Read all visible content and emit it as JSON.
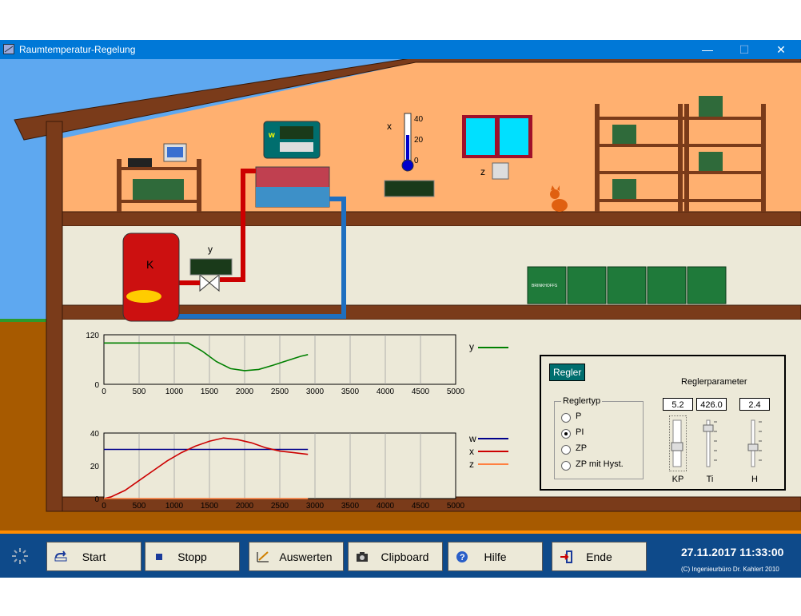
{
  "window": {
    "title": "Raumtemperatur-Regelung",
    "minimize": "—",
    "maximize": "☐",
    "close": "✕"
  },
  "scene": {
    "w_label": "w",
    "x_label": "x",
    "y_label": "y",
    "z_label": "z",
    "k_label": "K",
    "thermo_ticks": [
      "40",
      "20",
      "0"
    ],
    "crate_label": "BRINKHOFFS"
  },
  "chart_data": [
    {
      "type": "line",
      "xlim": [
        0,
        5000
      ],
      "ylim": [
        0,
        120
      ],
      "x_ticks": [
        "0",
        "500",
        "1000",
        "1500",
        "2000",
        "2500",
        "3000",
        "3500",
        "4000",
        "4500",
        "5000"
      ],
      "y_ticks": [
        "120",
        "0"
      ],
      "series": [
        {
          "name": "y",
          "color": "#008000",
          "x": [
            0,
            1000,
            1200,
            1400,
            1600,
            1800,
            2000,
            2200,
            2400,
            2600,
            2800,
            2900
          ],
          "y": [
            100,
            100,
            100,
            80,
            55,
            38,
            33,
            36,
            46,
            57,
            68,
            72
          ]
        }
      ]
    },
    {
      "type": "line",
      "xlim": [
        0,
        5000
      ],
      "ylim": [
        0,
        40
      ],
      "x_ticks": [
        "0",
        "500",
        "1000",
        "1500",
        "2000",
        "2500",
        "3000",
        "3500",
        "4000",
        "4500",
        "5000"
      ],
      "y_ticks": [
        "40",
        "20",
        "0"
      ],
      "series": [
        {
          "name": "w",
          "color": "#00008b",
          "x": [
            0,
            2900
          ],
          "y": [
            30,
            30
          ]
        },
        {
          "name": "x",
          "color": "#cc0000",
          "x": [
            0,
            100,
            300,
            500,
            700,
            900,
            1100,
            1300,
            1500,
            1700,
            1900,
            2100,
            2300,
            2500,
            2700,
            2900
          ],
          "y": [
            0,
            1,
            5,
            11,
            17,
            23,
            28,
            32,
            35,
            37,
            36,
            34,
            31,
            29,
            28,
            27
          ]
        },
        {
          "name": "z",
          "color": "#ff8040",
          "x": [
            0,
            2900
          ],
          "y": [
            0,
            0
          ]
        }
      ]
    }
  ],
  "regler": {
    "button_label": "Regler",
    "params_title": "Reglerparameter",
    "typ_title": "Reglertyp",
    "options": [
      {
        "label": "P",
        "selected": false
      },
      {
        "label": "PI",
        "selected": true
      },
      {
        "label": "ZP",
        "selected": false
      },
      {
        "label": "ZP mit Hyst.",
        "selected": false
      }
    ],
    "params": [
      {
        "name": "KP",
        "value": "5.2",
        "level": 0.5
      },
      {
        "name": "Ti",
        "value": "426.0",
        "level": 0.15
      },
      {
        "name": "H",
        "value": "2.4",
        "level": 0.55
      }
    ]
  },
  "toolbar": {
    "start": "Start",
    "stopp": "Stopp",
    "auswerten": "Auswerten",
    "clipboard": "Clipboard",
    "hilfe": "Hilfe",
    "ende": "Ende",
    "datetime": "27.11.2017  11:33:00",
    "copyright": "(C) Ingenieurbüro Dr. Kahlert 2010"
  },
  "colors": {
    "titlebar": "#0078d7",
    "sky": "#5ea8f0",
    "room": "#ffb070",
    "wall": "#7a3b1a",
    "basement": "#ece9d8",
    "ground": "#a75a00",
    "toolbar": "#0e4a8a"
  }
}
